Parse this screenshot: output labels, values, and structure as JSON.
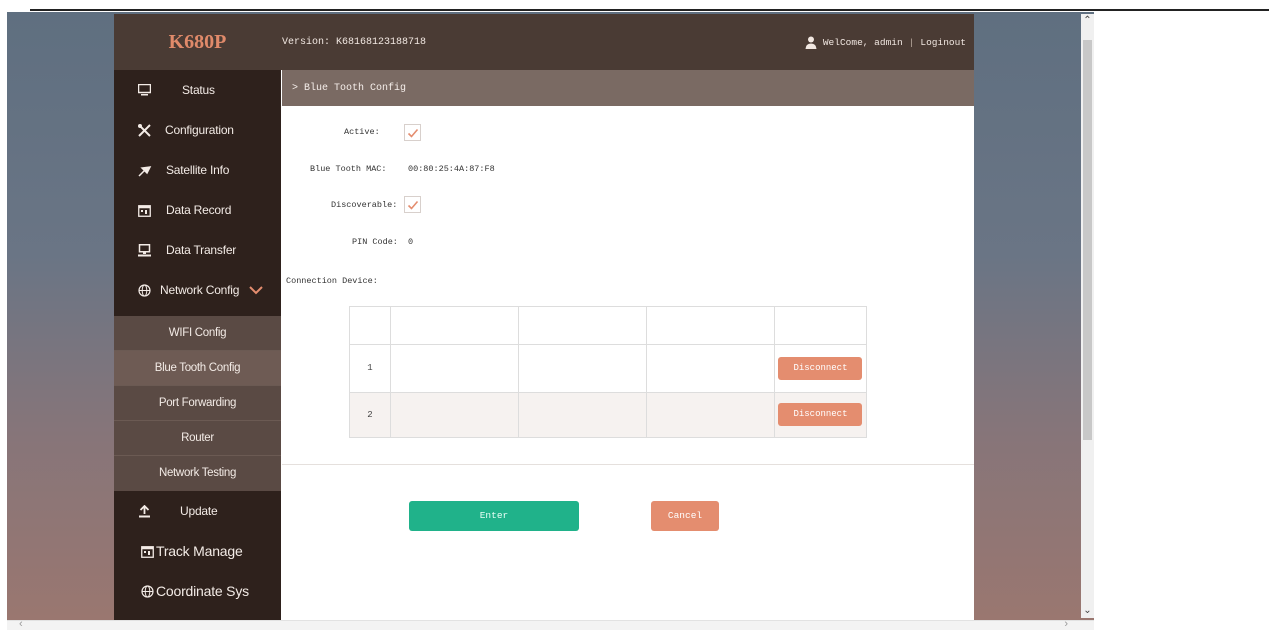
{
  "header": {
    "logo": "K680P",
    "version": "Version: K68168123188718",
    "welcome": "WelCome, admin",
    "separator": "|",
    "logout": "Loginout"
  },
  "sidebar": {
    "items": [
      {
        "label": "Status",
        "icon": "monitor-icon"
      },
      {
        "label": "Configuration",
        "icon": "tools-icon"
      },
      {
        "label": "Satellite Info",
        "icon": "satellite-icon"
      },
      {
        "label": "Data Record",
        "icon": "calendar-icon"
      },
      {
        "label": "Data Transfer",
        "icon": "computer-icon"
      },
      {
        "label": "Network Config",
        "icon": "globe-icon",
        "expanded": true
      }
    ],
    "submenu": [
      {
        "label": "WIFI Config"
      },
      {
        "label": "Blue Tooth Config",
        "active": true
      },
      {
        "label": "Port Forwarding"
      },
      {
        "label": "Router"
      },
      {
        "label": "Network Testing"
      }
    ],
    "bottom_items": [
      {
        "label": "Update",
        "icon": "upload-icon"
      },
      {
        "label": "Track Manage",
        "icon": "calendar-icon"
      },
      {
        "label": "Coordinate Sys",
        "icon": "globe-icon"
      }
    ]
  },
  "breadcrumb": "> Blue Tooth Config",
  "form": {
    "active_label": "Active:",
    "active_checked": true,
    "mac_label": "Blue Tooth MAC:",
    "mac_value": "00:80:25:4A:87:F8",
    "discoverable_label": "Discoverable:",
    "discoverable_checked": true,
    "pin_label": "PIN Code:",
    "pin_value": "0",
    "connection_label": "Connection Device:"
  },
  "devices": {
    "rows": [
      {
        "index": "1",
        "action": "Disconnect"
      },
      {
        "index": "2",
        "action": "Disconnect"
      }
    ]
  },
  "buttons": {
    "enter": "Enter",
    "cancel": "Cancel"
  },
  "colors": {
    "topbar": "#4a3b34",
    "sidebar": "#2e211c",
    "accent_orange": "#e48d6f",
    "accent_green": "#20b28a",
    "logo": "#e08a6a"
  }
}
